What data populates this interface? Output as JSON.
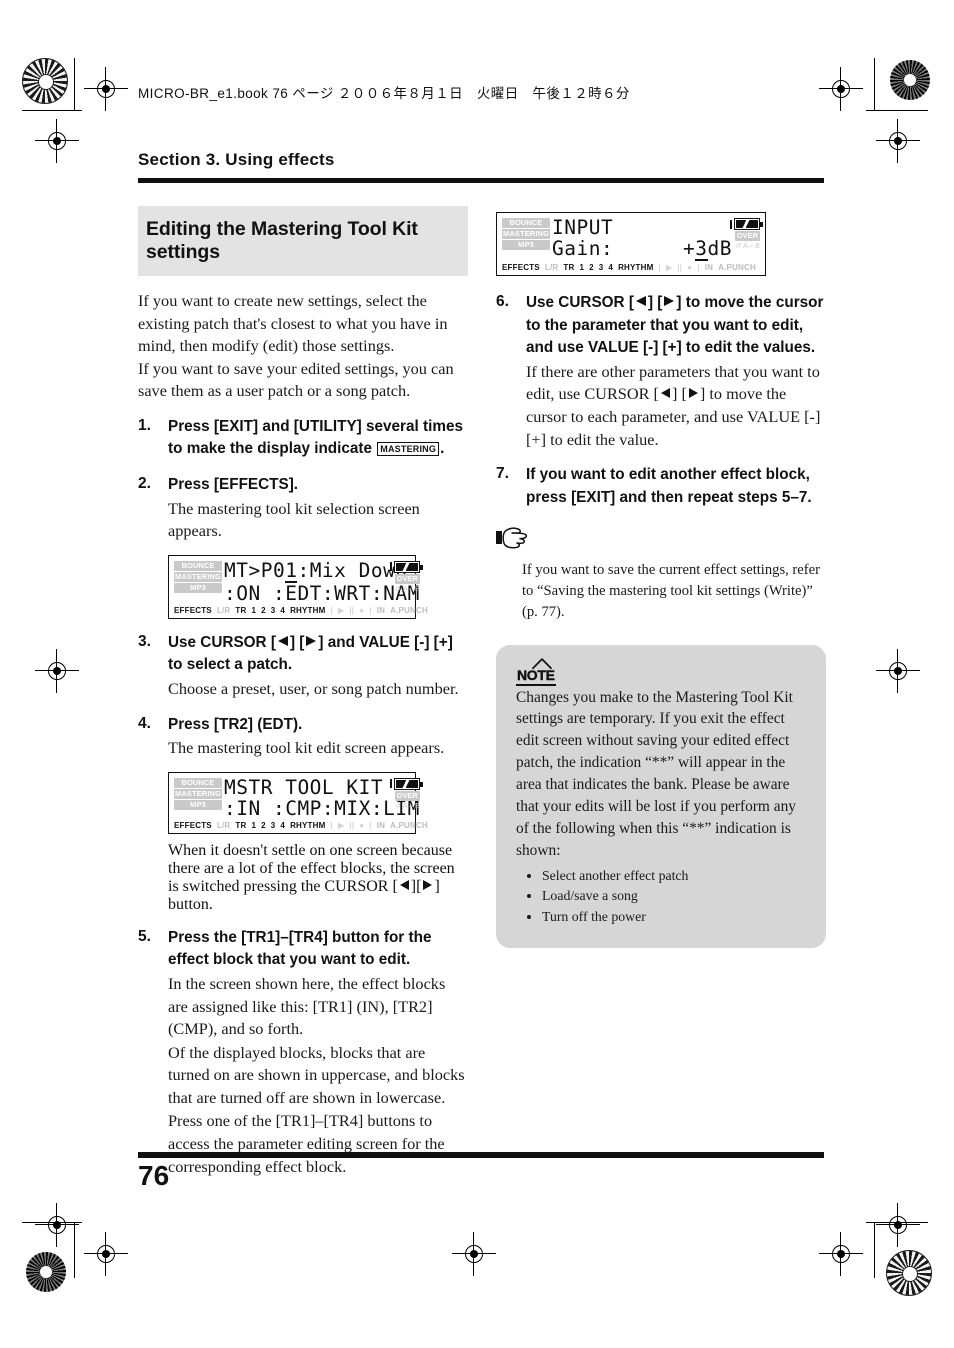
{
  "header": {
    "running_head": "MICRO-BR_e1.book 76 ページ ２００６年８月１日　火曜日　午後１２時６分"
  },
  "section": {
    "title": "Section 3. Using effects"
  },
  "heading": {
    "title": "Editing the Mastering Tool Kit settings"
  },
  "intro": {
    "para1": "If you want to create new settings, select the existing patch that's closest to what you have in mind, then modify (edit) those settings.",
    "para2": "If you want to save your edited settings, you can save them as a user patch or a song patch."
  },
  "steps": {
    "s1": {
      "num": "1.",
      "lead_a": "Press [EXIT] and [UTILITY] several times to make the display indicate",
      "badge": "MASTERING",
      "lead_b": "."
    },
    "s2": {
      "num": "2.",
      "lead": "Press [EFFECTS].",
      "detail": "The mastering tool kit selection screen appears."
    },
    "s3": {
      "num": "3.",
      "lead_a": "Use CURSOR [",
      "lead_b": "] [",
      "lead_c": "] and VALUE [-] [+] to select a patch.",
      "detail": "Choose a preset, user, or song patch number."
    },
    "s4": {
      "num": "4.",
      "lead": "Press [TR2] (EDT).",
      "detail": "The mastering tool kit edit screen appears."
    },
    "s4_after": {
      "line_a": "When it doesn't settle on one screen because there are a lot of the effect blocks, the screen is switched pressing the CURSOR",
      "line_b": "[",
      "line_c": "][",
      "line_d": "] button."
    },
    "s5": {
      "num": "5.",
      "lead": "Press the [TR1]–[TR4] button for the effect block that you want to edit.",
      "detail1": "In the screen shown here, the effect blocks are assigned like this: [TR1] (IN), [TR2] (CMP), and so forth.",
      "detail2": "Of the displayed blocks, blocks that are turned on are shown in uppercase, and blocks that are turned off are shown in lowercase.",
      "detail3": "Press one of the [TR1]–[TR4] buttons to access the parameter editing screen for the corresponding effect block."
    },
    "s6": {
      "num": "6.",
      "lead_a": "Use CURSOR [",
      "lead_b": "] [",
      "lead_c": "] to move the cursor to the parameter that you want to edit, and use VALUE [-] [+] to edit the values.",
      "detail_a": "If there are other parameters that you want to edit, use CURSOR [",
      "detail_b": "] [",
      "detail_c": "] to move the cursor to each parameter, and use VALUE [-] [+] to edit the value."
    },
    "s7": {
      "num": "7.",
      "lead": "If you want to edit another effect block, press [EXIT] and then repeat steps 5–7."
    }
  },
  "hand_note": {
    "text": "If you want to save the current effect settings, refer to “Saving the mastering tool kit settings (Write)” (p. 77)."
  },
  "note": {
    "badge": "NOTE",
    "body": "Changes you make to the Mastering Tool Kit settings are temporary. If you exit the effect edit screen without saving your edited effect patch, the indication “**” will appear in the area that indicates the bank. Please be aware that your edits will be lost if you perform any of the following when this “**” indication is shown:",
    "bullets": [
      "Select another effect patch",
      "Load/save a song",
      "Turn off the power"
    ]
  },
  "lcd_common": {
    "side_labels": [
      "BOUNCE",
      "MASTERING",
      "MP3"
    ],
    "status": {
      "effects": "EFFECTS",
      "lr": "L/R",
      "tr": "TR",
      "tracks": [
        "1",
        "2",
        "3",
        "4"
      ],
      "rhythm": "RHYTHM",
      "play": "▶",
      "pause": "||",
      "record": "●",
      "in": "IN",
      "apunch": "A.PUNCH"
    },
    "over_chip": "OVER",
    "ab_chip": "↺ A⇔B"
  },
  "lcd_input": {
    "line1": "INPUT",
    "line2_label": "Gain:",
    "line2_value_pre": "+",
    "line2_value_cursor": "3",
    "line2_value_post": "dB"
  },
  "lcd_select": {
    "line1_pre": "MT>P0",
    "line1_cursor": "1",
    "line1_post": ":Mix Down",
    "line2": ":ON :EDT:WRT:NAM"
  },
  "lcd_edit": {
    "line1": "MSTR TOOL KIT",
    "line2": ":IN :CMP:MIX:LIM"
  },
  "footer": {
    "page_number": "76"
  },
  "colors": {
    "heading_bg": "#e3e3e3",
    "note_bg": "#d6d6d6",
    "rule": "#111111",
    "lcd_dim": "#c9c9c9"
  }
}
